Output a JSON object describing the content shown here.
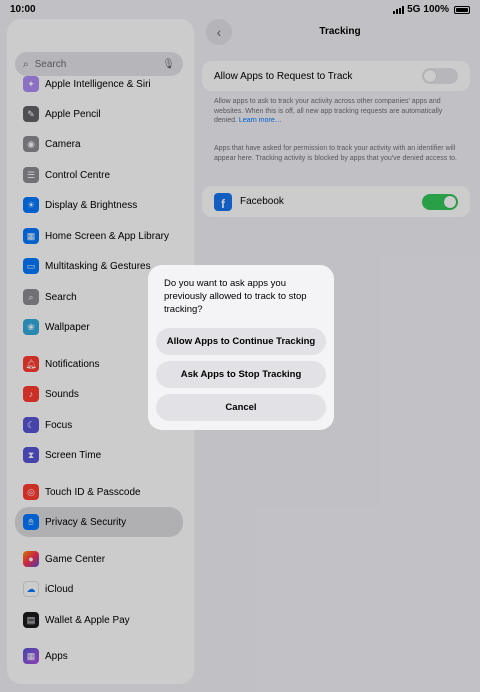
{
  "status_bar": {
    "time": "10:00",
    "network": "5G",
    "battery": "100%"
  },
  "sidebar": {
    "search_placeholder": "Search",
    "items": [
      {
        "label": "Apple Intelligence & Siri",
        "icon": "apple-intelligence-icon",
        "color": "#8e6cf0"
      },
      {
        "label": "Apple Pencil",
        "icon": "pencil-icon",
        "color": "#6b6b70"
      },
      {
        "label": "Camera",
        "icon": "camera-icon",
        "color": "#8e8e93"
      },
      {
        "label": "Control Centre",
        "icon": "control-centre-icon",
        "color": "#8e8e93"
      },
      {
        "label": "Display & Brightness",
        "icon": "brightness-icon",
        "color": "#007aff"
      },
      {
        "label": "Home Screen & App Library",
        "icon": "home-screen-icon",
        "color": "#007aff"
      },
      {
        "label": "Multitasking & Gestures",
        "icon": "multitasking-icon",
        "color": "#007aff"
      },
      {
        "label": "Search",
        "icon": "search-icon",
        "color": "#8e8e93"
      },
      {
        "label": "Wallpaper",
        "icon": "wallpaper-icon",
        "color": "#34aadc"
      },
      {
        "label": "Notifications",
        "icon": "bell-icon",
        "color": "#ff3b30"
      },
      {
        "label": "Sounds",
        "icon": "speaker-icon",
        "color": "#ff3b30"
      },
      {
        "label": "Focus",
        "icon": "moon-icon",
        "color": "#5856d6"
      },
      {
        "label": "Screen Time",
        "icon": "hourglass-icon",
        "color": "#5856d6"
      },
      {
        "label": "Touch ID & Passcode",
        "icon": "fingerprint-icon",
        "color": "#ff3b30"
      },
      {
        "label": "Privacy & Security",
        "icon": "hand-icon",
        "color": "#007aff"
      },
      {
        "label": "Game Center",
        "icon": "game-center-icon",
        "color": "#ff2d55"
      },
      {
        "label": "iCloud",
        "icon": "cloud-icon",
        "color": "#ffffff"
      },
      {
        "label": "Wallet & Apple Pay",
        "icon": "wallet-icon",
        "color": "#1c1c1e"
      },
      {
        "label": "Apps",
        "icon": "apps-icon",
        "color": "#5856d6"
      }
    ]
  },
  "detail": {
    "title": "Tracking",
    "allow_label": "Allow Apps to Request to Track",
    "allow_note": "Allow apps to ask to track your activity across other companies' apps and websites. When this is off, all new app tracking requests are automatically denied.",
    "learn_more": "Learn more…",
    "apps_note": "Apps that have asked for permission to track your activity with an identifier will appear here. Tracking activity is blocked by apps that you've denied access to.",
    "app_name": "Facebook",
    "toggle_on_color": "#34c759"
  },
  "alert": {
    "message": "Do you want to ask apps you previously allowed to track to stop tracking?",
    "continue_label": "Allow Apps to Continue Tracking",
    "stop_label": "Ask Apps to Stop Tracking",
    "cancel_label": "Cancel"
  }
}
